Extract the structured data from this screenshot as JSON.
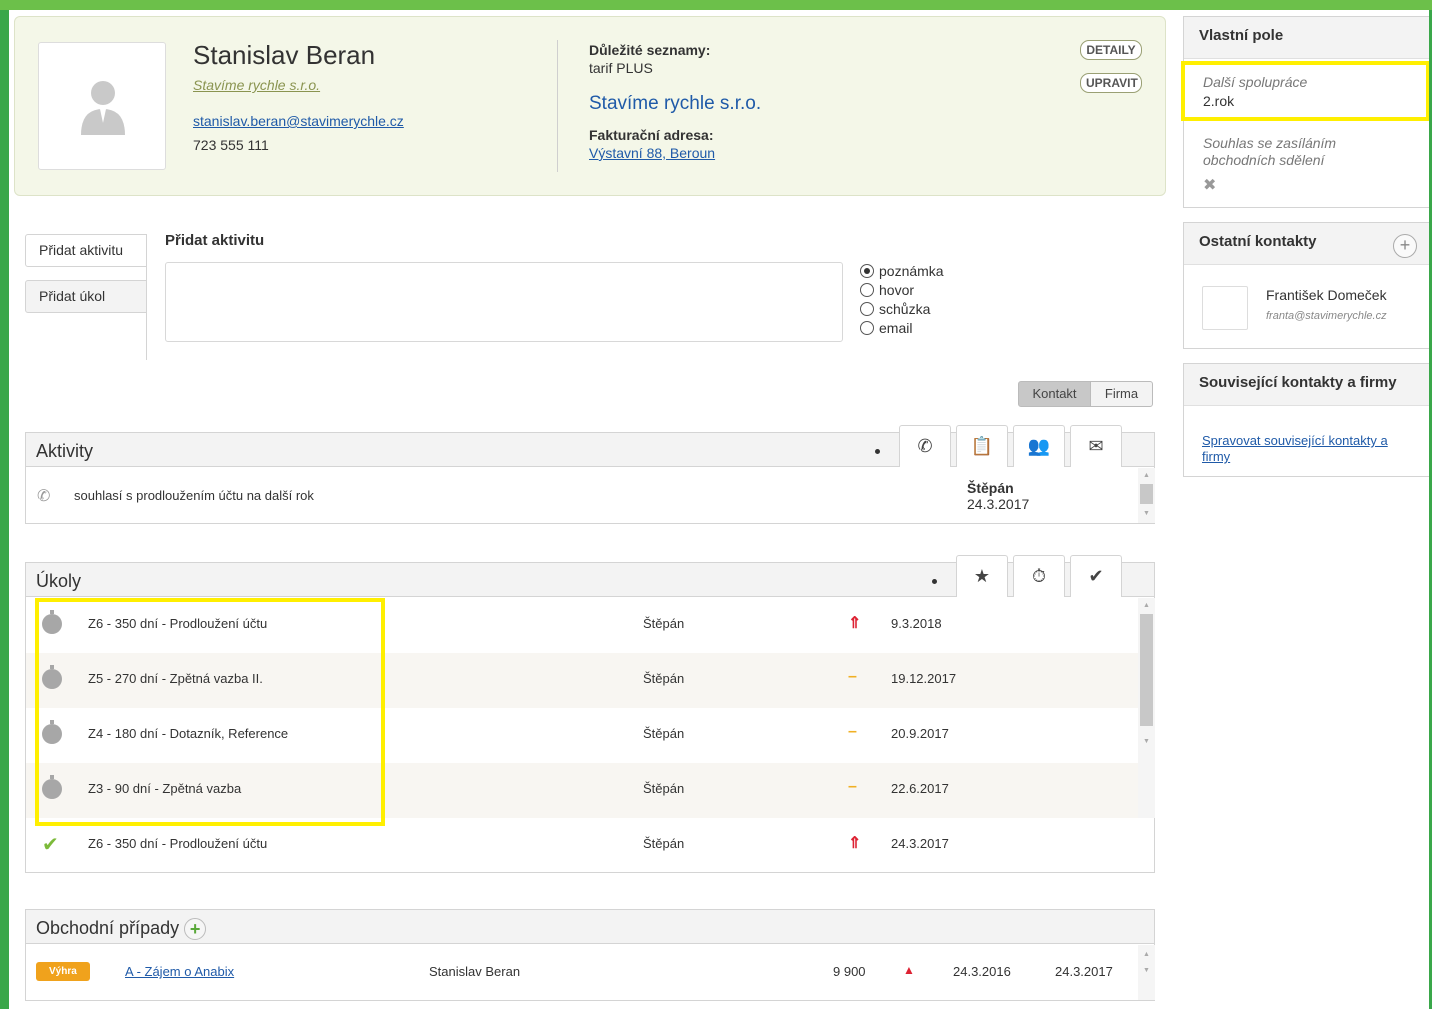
{
  "contact": {
    "name": "Stanislav Beran",
    "company": "Stavíme rychle s.r.o.",
    "email": "stanislav.beran@stavimerychle.cz",
    "phone": "723 555 111"
  },
  "lists": {
    "label": "Důležité seznamy:",
    "value": "tarif PLUS"
  },
  "company_block": {
    "name": "Stavíme rychle s.r.o.",
    "billing_label": "Fakturační adresa:",
    "billing_address": "Výstavní 88, Beroun"
  },
  "header_buttons": {
    "detail": "DETAILY",
    "edit": "UPRAVIT"
  },
  "add_activity": {
    "tabs": [
      "Přidat aktivitu",
      "Přidat úkol"
    ],
    "title": "Přidat aktivitu",
    "types": [
      "poznámka",
      "hovor",
      "schůzka",
      "email"
    ],
    "selected_type": "poznámka"
  },
  "toggle": {
    "contact": "Kontakt",
    "company": "Firma",
    "active": "Kontakt"
  },
  "activities": {
    "title": "Aktivity",
    "items": [
      {
        "text": "souhlasí s prodloužením účtu na další rok",
        "user": "Štěpán",
        "date": "24.3.2017",
        "icon": "phone-icon"
      }
    ]
  },
  "tasks": {
    "title": "Úkoly",
    "items": [
      {
        "title": "Z6 - 350 dní - Prodloužení účtu",
        "user": "Štěpán",
        "priority": "high",
        "priority_glyph": "⇑",
        "date": "9.3.2018",
        "status": "pending"
      },
      {
        "title": "Z5 - 270 dní - Zpětná vazba II.",
        "user": "Štěpán",
        "priority": "normal",
        "priority_glyph": "–",
        "date": "19.12.2017",
        "status": "pending"
      },
      {
        "title": "Z4 - 180 dní - Dotazník, Reference",
        "user": "Štěpán",
        "priority": "normal",
        "priority_glyph": "–",
        "date": "20.9.2017",
        "status": "pending"
      },
      {
        "title": "Z3 - 90 dní - Zpětná vazba",
        "user": "Štěpán",
        "priority": "normal",
        "priority_glyph": "–",
        "date": "22.6.2017",
        "status": "pending"
      },
      {
        "title": "Z6 - 350 dní - Prodloužení účtu",
        "user": "Štěpán",
        "priority": "high",
        "priority_glyph": "⇑",
        "date": "24.3.2017",
        "status": "done"
      }
    ]
  },
  "deals": {
    "title": "Obchodní případy",
    "items": [
      {
        "badge": "Výhra",
        "name": "A - Zájem o Anabix",
        "person": "Stanislav Beran",
        "amount": "9 900",
        "date_from": "24.3.2016",
        "date_to": "24.3.2017"
      }
    ]
  },
  "sidebar": {
    "custom_fields": {
      "title": "Vlastní pole",
      "fields": [
        {
          "label": "Další spolupráce",
          "value": "2.rok"
        },
        {
          "label": "Souhlas se zasíláním obchodních sdělení",
          "value": "✖"
        }
      ]
    },
    "other_contacts": {
      "title": "Ostatní kontakty",
      "items": [
        {
          "name": "František Domeček",
          "email": "franta@stavimerychle.cz"
        }
      ]
    },
    "related": {
      "title": "Související kontakty a firmy",
      "link": "Spravovat související kontakty a firmy"
    }
  },
  "colors": {
    "frame": "#3aa74a",
    "highlight": "#ffef00",
    "win_badge": "#f0a21c",
    "link": "#1f5aa8"
  }
}
